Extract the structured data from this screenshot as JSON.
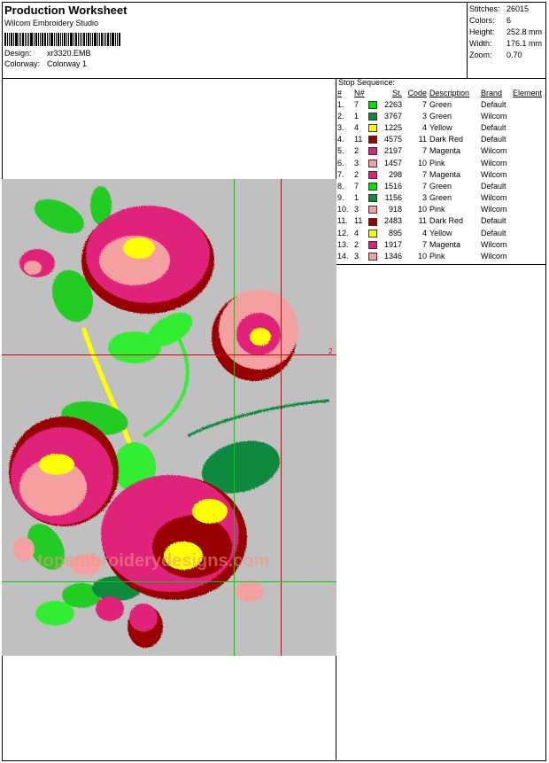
{
  "header": {
    "title": "Production Worksheet",
    "company": "Wilcom  Embroidery Studio",
    "design_label": "Design:",
    "design_value": "xr3320.EMB",
    "colorway_label": "Colorway:",
    "colorway_value": "Colorway 1"
  },
  "stats": [
    {
      "label": "Stitches:",
      "value": "26015"
    },
    {
      "label": "Colors:",
      "value": "6"
    },
    {
      "label": "Height:",
      "value": "252.8 mm"
    },
    {
      "label": "Width:",
      "value": "176.1 mm"
    },
    {
      "label": "Zoom:",
      "value": "0.70"
    }
  ],
  "stop_sequence": {
    "title": "Stop Sequence:",
    "columns": [
      "#",
      "N#",
      "St.",
      "Code",
      "Description",
      "Brand",
      "Element"
    ],
    "rows": [
      {
        "num": "1.",
        "n": "7",
        "color": "#00e000",
        "st": "2263",
        "code": "7",
        "desc": "Green",
        "brand": "Default"
      },
      {
        "num": "2.",
        "n": "1",
        "color": "#0a8a3c",
        "st": "3767",
        "code": "3",
        "desc": "Green",
        "brand": "Wilcom"
      },
      {
        "num": "3.",
        "n": "4",
        "color": "#ffff00",
        "st": "1225",
        "code": "4",
        "desc": "Yellow",
        "brand": "Default"
      },
      {
        "num": "4.",
        "n": "11",
        "color": "#990000",
        "st": "4575",
        "code": "11",
        "desc": "Dark Red",
        "brand": "Default"
      },
      {
        "num": "5.",
        "n": "2",
        "color": "#e0207a",
        "st": "2197",
        "code": "7",
        "desc": "Magenta",
        "brand": "Wilcom"
      },
      {
        "num": "6.",
        "n": "3",
        "color": "#f4a0a0",
        "st": "1457",
        "code": "10",
        "desc": "Pink",
        "brand": "Wilcom"
      },
      {
        "num": "7.",
        "n": "2",
        "color": "#e0207a",
        "st": "298",
        "code": "7",
        "desc": "Magenta",
        "brand": "Wilcom"
      },
      {
        "num": "8.",
        "n": "7",
        "color": "#00e000",
        "st": "1516",
        "code": "7",
        "desc": "Green",
        "brand": "Default"
      },
      {
        "num": "9.",
        "n": "1",
        "color": "#0a8a3c",
        "st": "1156",
        "code": "3",
        "desc": "Green",
        "brand": "Wilcom"
      },
      {
        "num": "10.",
        "n": "3",
        "color": "#f4a0a0",
        "st": "918",
        "code": "10",
        "desc": "Pink",
        "brand": "Wilcom"
      },
      {
        "num": "11.",
        "n": "11",
        "color": "#990000",
        "st": "2483",
        "code": "11",
        "desc": "Dark Red",
        "brand": "Default"
      },
      {
        "num": "12.",
        "n": "4",
        "color": "#ffff00",
        "st": "895",
        "code": "4",
        "desc": "Yellow",
        "brand": "Default"
      },
      {
        "num": "13.",
        "n": "2",
        "color": "#e0207a",
        "st": "1917",
        "code": "7",
        "desc": "Magenta",
        "brand": "Wilcom"
      },
      {
        "num": "14.",
        "n": "3",
        "color": "#f4a0a0",
        "st": "1346",
        "code": "10",
        "desc": "Pink",
        "brand": "Wilcom"
      }
    ]
  },
  "preview": {
    "guide_label": "2",
    "watermark": "topembroiderydesigns.com"
  },
  "colors": {
    "guide_red": "#e00000",
    "guide_green": "#00d000",
    "preview_bg": "#c0c0c0"
  }
}
